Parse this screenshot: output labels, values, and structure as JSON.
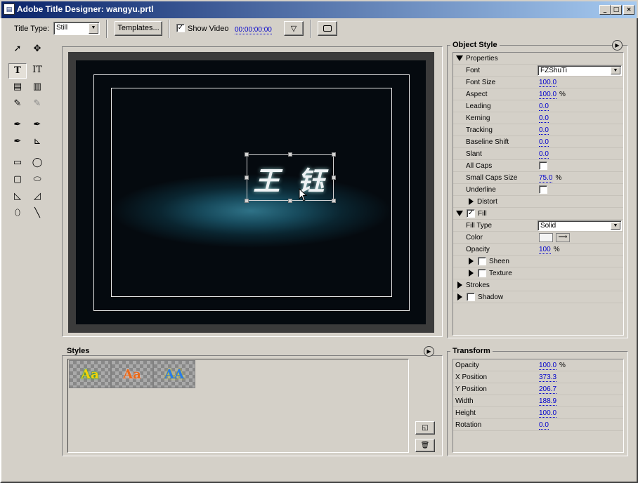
{
  "window": {
    "title": "Adobe Title Designer: wangyu.prtl"
  },
  "toolbar": {
    "title_type_label": "Title Type:",
    "title_type_value": "Still",
    "templates_label": "Templates...",
    "show_video_label": "Show Video",
    "show_video_checked": "✓",
    "timecode": "00:00:00:00"
  },
  "canvas": {
    "title_text": "王 钰"
  },
  "object_style": {
    "title": "Object Style",
    "properties_label": "Properties",
    "font_label": "Font",
    "font_value": "FZShuTi",
    "font_size_label": "Font Size",
    "font_size_value": "100.0",
    "aspect_label": "Aspect",
    "aspect_value": "100.0",
    "aspect_unit": "%",
    "leading_label": "Leading",
    "leading_value": "0.0",
    "kerning_label": "Kerning",
    "kerning_value": "0.0",
    "tracking_label": "Tracking",
    "tracking_value": "0.0",
    "baseline_shift_label": "Baseline Shift",
    "baseline_shift_value": "0.0",
    "slant_label": "Slant",
    "slant_value": "0.0",
    "all_caps_label": "All Caps",
    "small_caps_size_label": "Small Caps Size",
    "small_caps_size_value": "75.0",
    "small_caps_unit": "%",
    "underline_label": "Underline",
    "distort_label": "Distort",
    "fill_label": "Fill",
    "fill_checked": "✓",
    "fill_type_label": "Fill Type",
    "fill_type_value": "Solid",
    "color_label": "Color",
    "opacity_label": "Opacity",
    "opacity_value": "100",
    "opacity_unit": "%",
    "sheen_label": "Sheen",
    "texture_label": "Texture",
    "strokes_label": "Strokes",
    "shadow_label": "Shadow"
  },
  "styles": {
    "title": "Styles",
    "thumbs": [
      "Aa",
      "Aa",
      "AA"
    ]
  },
  "transform": {
    "title": "Transform",
    "opacity_label": "Opacity",
    "opacity_value": "100.0",
    "opacity_unit": "%",
    "x_label": "X Position",
    "x_value": "373.3",
    "y_label": "Y Position",
    "y_value": "206.7",
    "width_label": "Width",
    "width_value": "188.9",
    "height_label": "Height",
    "height_value": "100.0",
    "rotation_label": "Rotation",
    "rotation_value": "0.0"
  }
}
